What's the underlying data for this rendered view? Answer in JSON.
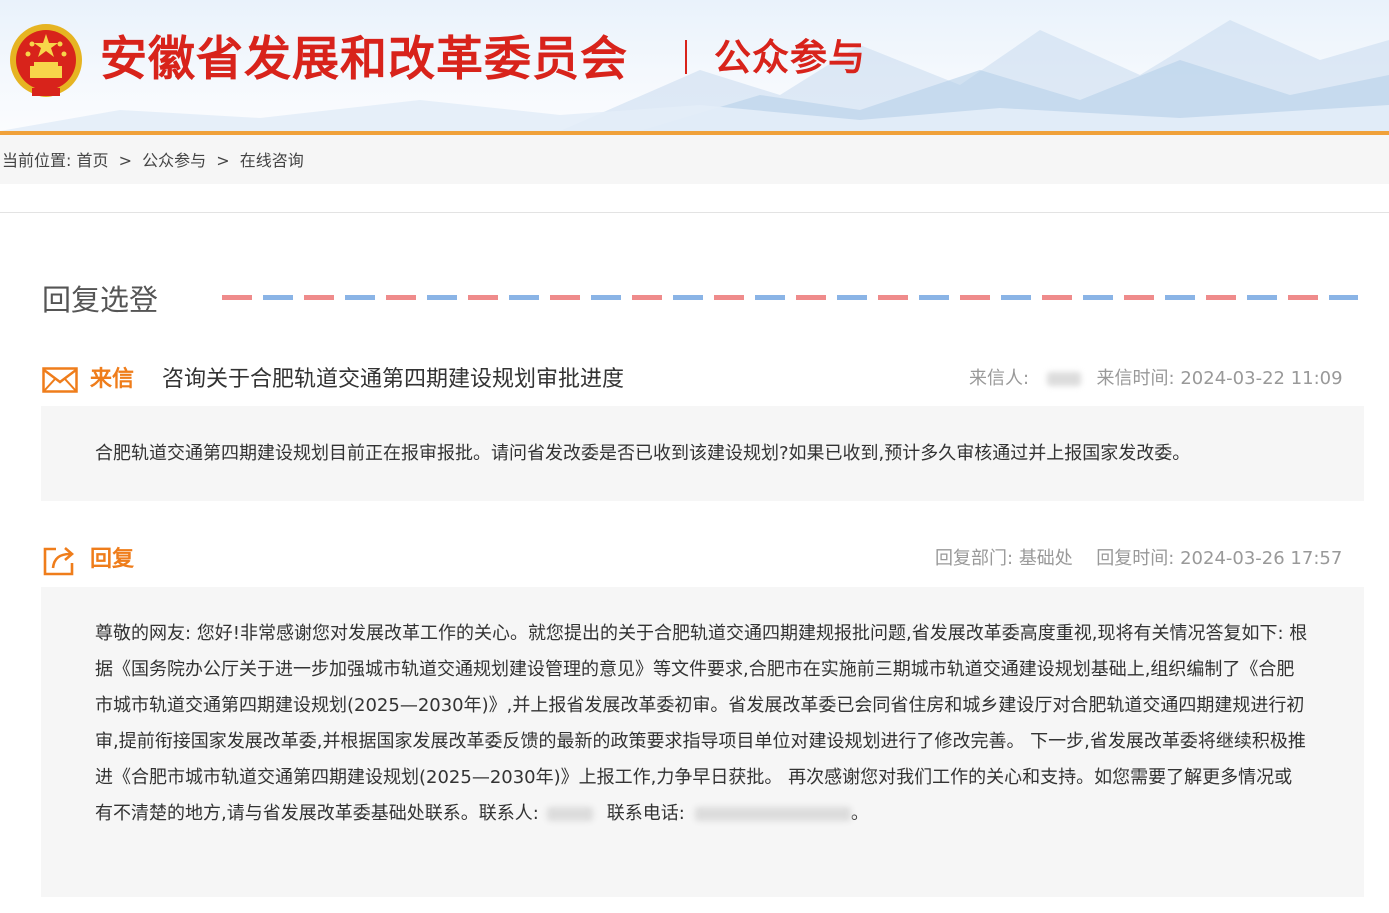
{
  "header": {
    "site_title": "安徽省发展和改革委员会",
    "section_title": "公众参与",
    "colors": {
      "brand_red": "#d8231b",
      "accent_orange": "#f0a13a",
      "label_orange": "#ef7d1b"
    }
  },
  "breadcrumb": {
    "prefix": "当前位置:",
    "items": [
      "首页",
      "公众参与",
      "在线咨询"
    ],
    "separator": ">"
  },
  "page": {
    "heading": "回复选登"
  },
  "letter": {
    "label": "来信",
    "icon": "envelope-icon",
    "subject": "咨询关于合肥轨道交通第四期建设规划审批进度",
    "sender_label": "来信人:",
    "time_label": "来信时间:",
    "time": "2024-03-22 11:09",
    "body": "合肥轨道交通第四期建设规划目前正在报审报批。请问省发改委是否已收到该建设规划?如果已收到,预计多久审核通过并上报国家发改委。"
  },
  "reply": {
    "label": "回复",
    "icon": "share-reply-icon",
    "dept_label": "回复部门:",
    "dept": "基础处",
    "time_label": "回复时间:",
    "time": "2024-03-26 17:57",
    "body_main": "尊敬的网友: 您好!非常感谢您对发展改革工作的关心。就您提出的关于合肥轨道交通四期建规报批问题,省发展改革委高度重视,现将有关情况答复如下: 根据《国务院办公厅关于进一步加强城市轨道交通规划建设管理的意见》等文件要求,合肥市在实施前三期城市轨道交通建设规划基础上,组织编制了《合肥市城市轨道交通第四期建设规划(2025—2030年)》,并上报省发展改革委初审。省发展改革委已会同省住房和城乡建设厅对合肥轨道交通四期建规进行初审,提前衔接国家发展改革委,并根据国家发展改革委反馈的最新的政策要求指导项目单位对建设规划进行了修改完善。 下一步,省发展改革委将继续积极推进《合肥市城市轨道交通第四期建设规划(2025—2030年)》上报工作,力争早日获批。 再次感谢您对我们工作的关心和支持。如您需要了解更多情况或有不清楚的地方,请与省发展改革委基础处联系。联系人:",
    "contact_tail": "联系电话:",
    "end_mark": "。"
  }
}
